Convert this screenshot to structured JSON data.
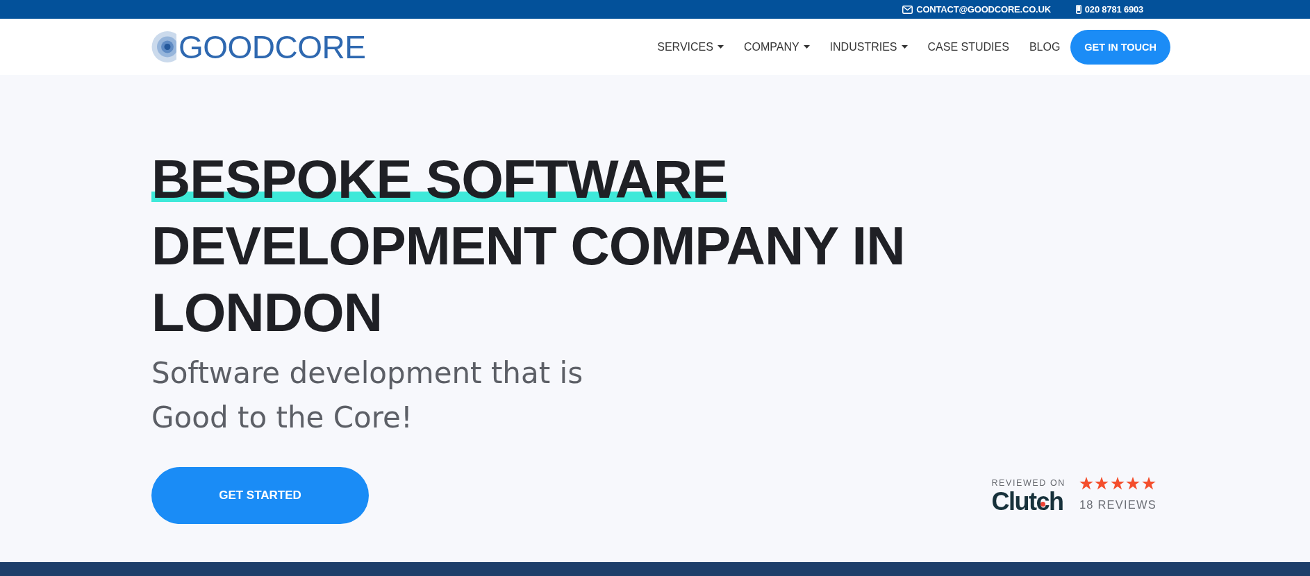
{
  "top_bar": {
    "email": "CONTACT@GOODCORE.CO.UK",
    "phone": "020 8781 6903"
  },
  "header": {
    "logo": "GOODCORE",
    "nav": [
      {
        "label": "SERVICES",
        "dropdown": true
      },
      {
        "label": "COMPANY",
        "dropdown": true
      },
      {
        "label": "INDUSTRIES",
        "dropdown": true
      },
      {
        "label": "CASE STUDIES",
        "dropdown": false
      },
      {
        "label": "BLOG",
        "dropdown": false
      }
    ],
    "cta": "GET IN TOUCH"
  },
  "hero": {
    "headline": {
      "highlighted": "BESPOKE SOFTWARE",
      "rest": "DEVELOPMENT COMPANY IN LONDON"
    },
    "subtitle": "Software development that is\nGood to the Core!",
    "button": "GET STARTED",
    "clutch": {
      "label": "REVIEWED ON",
      "brand": "Clutch",
      "stars": 5,
      "reviews": "18 REVIEWS"
    }
  }
}
